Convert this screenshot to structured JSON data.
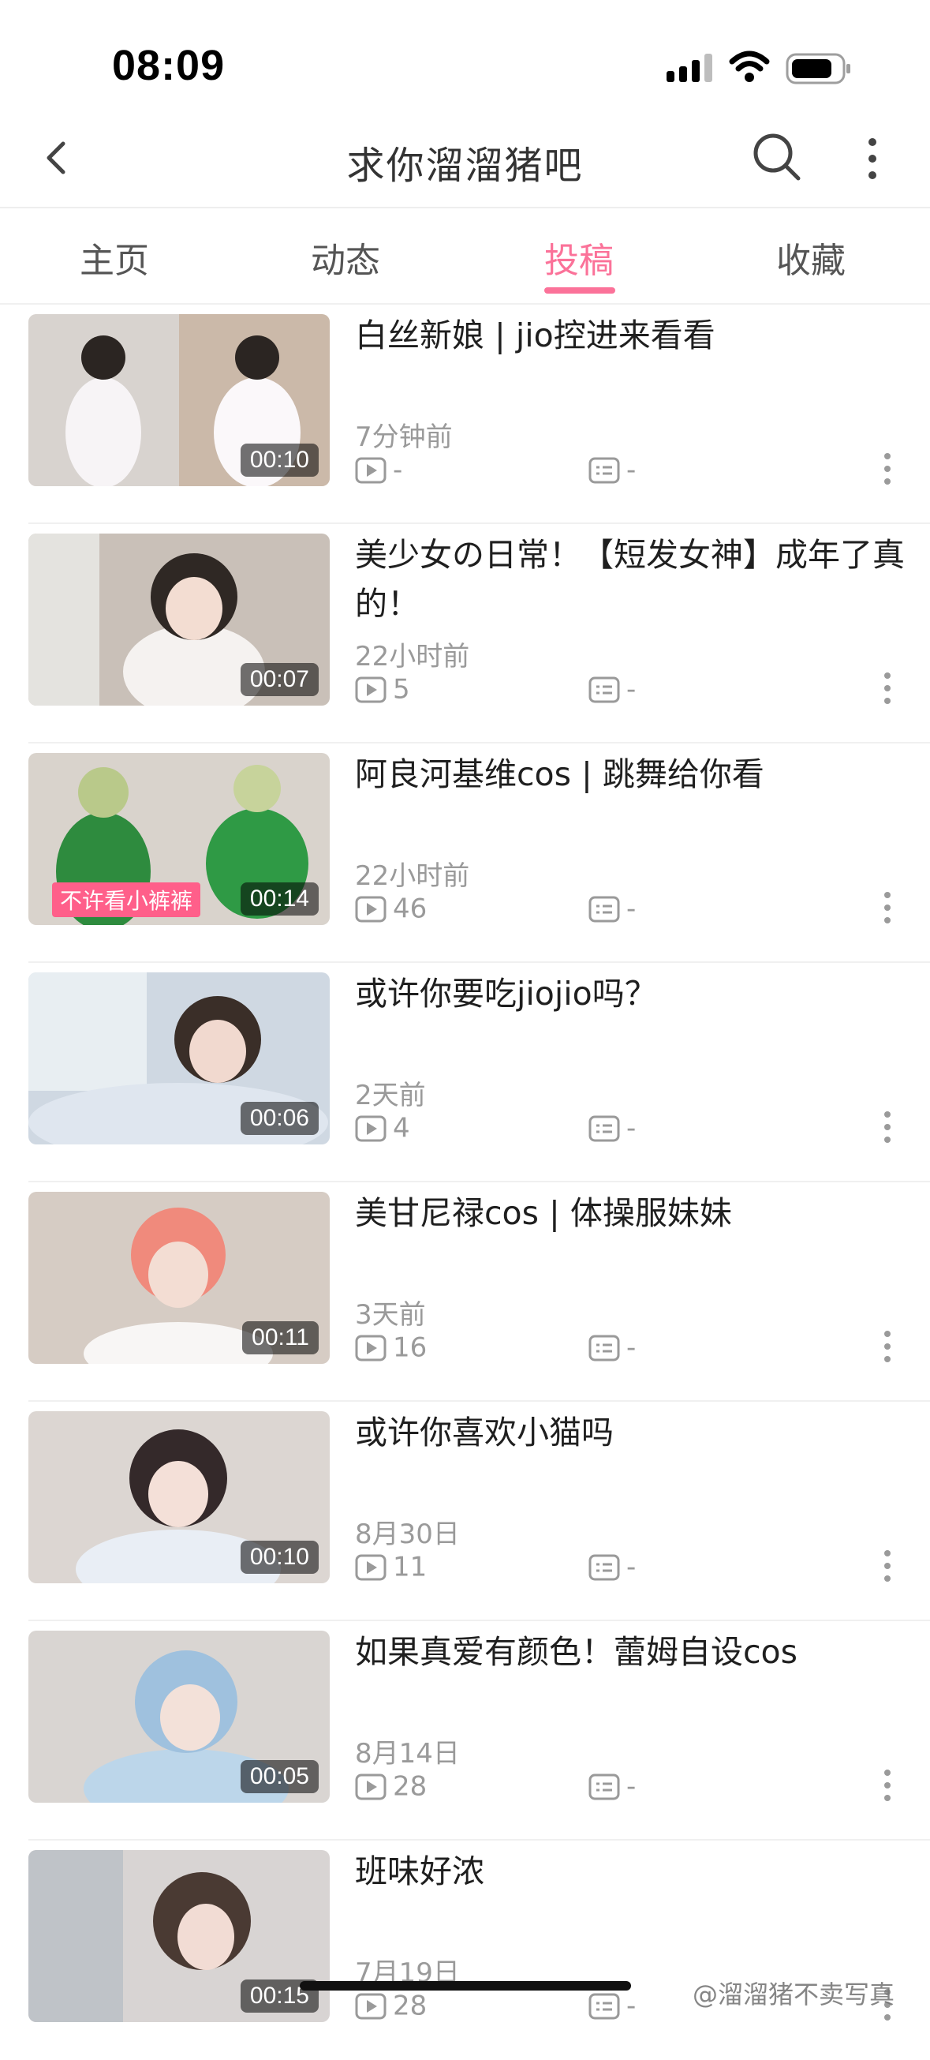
{
  "status_bar": {
    "time": "08:09"
  },
  "nav": {
    "title": "求你溜溜猪吧"
  },
  "tabs": [
    {
      "label": "主页",
      "active": false
    },
    {
      "label": "动态",
      "active": false
    },
    {
      "label": "投稿",
      "active": true
    },
    {
      "label": "收藏",
      "active": false
    }
  ],
  "accent_color": "#fb7299",
  "videos": [
    {
      "title": "白丝新娘 | jio控进来看看",
      "time_ago": "7分钟前",
      "plays": "-",
      "comments": "-",
      "duration": "00:10"
    },
    {
      "title": "美少女の日常！【短发女神】成年了真的！",
      "time_ago": "22小时前",
      "plays": "5",
      "comments": "-",
      "duration": "00:07"
    },
    {
      "title": "阿良河基维cos | 跳舞给你看",
      "time_ago": "22小时前",
      "plays": "46",
      "comments": "-",
      "duration": "00:14",
      "overlay_text": "不许看小裤裤"
    },
    {
      "title": "或许你要吃jiojio吗？",
      "time_ago": "2天前",
      "plays": "4",
      "comments": "-",
      "duration": "00:06"
    },
    {
      "title": "美甘尼禄cos | 体操服妹妹",
      "time_ago": "3天前",
      "plays": "16",
      "comments": "-",
      "duration": "00:11"
    },
    {
      "title": "或许你喜欢小猫吗",
      "time_ago": "8月30日",
      "plays": "11",
      "comments": "-",
      "duration": "00:10"
    },
    {
      "title": "如果真爱有颜色！蕾姆自设cos",
      "time_ago": "8月14日",
      "plays": "28",
      "comments": "-",
      "duration": "00:05"
    },
    {
      "title": "班味好浓",
      "time_ago": "7月19日",
      "plays": "28",
      "comments": "-",
      "duration": "00:15"
    }
  ],
  "watermark": "@溜溜猪不卖写真"
}
